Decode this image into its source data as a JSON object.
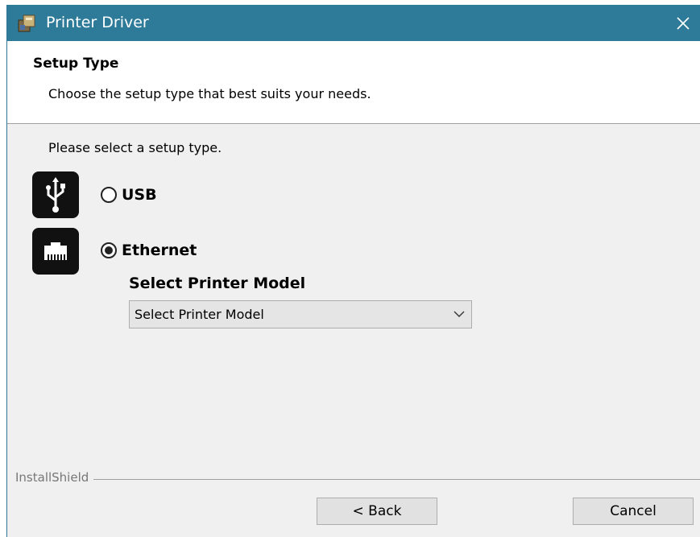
{
  "window": {
    "title": "Printer Driver",
    "close_glyph": "✕",
    "app_icon": "installer-icon",
    "titlebar_color": "#2e7b99"
  },
  "header": {
    "title": "Setup Type",
    "subtitle": "Choose the setup type that best suits your needs."
  },
  "body": {
    "prompt": "Please select a setup type.",
    "options": [
      {
        "label": "USB",
        "icon": "usb-icon",
        "selected": false
      },
      {
        "label": "Ethernet",
        "icon": "ethernet-port-icon",
        "selected": true
      }
    ],
    "model_label": "Select Printer Model",
    "model_select": {
      "value": "Select Printer Model"
    }
  },
  "footer": {
    "brand": "InstallShield",
    "back_label": "< Back",
    "cancel_label": "Cancel"
  }
}
